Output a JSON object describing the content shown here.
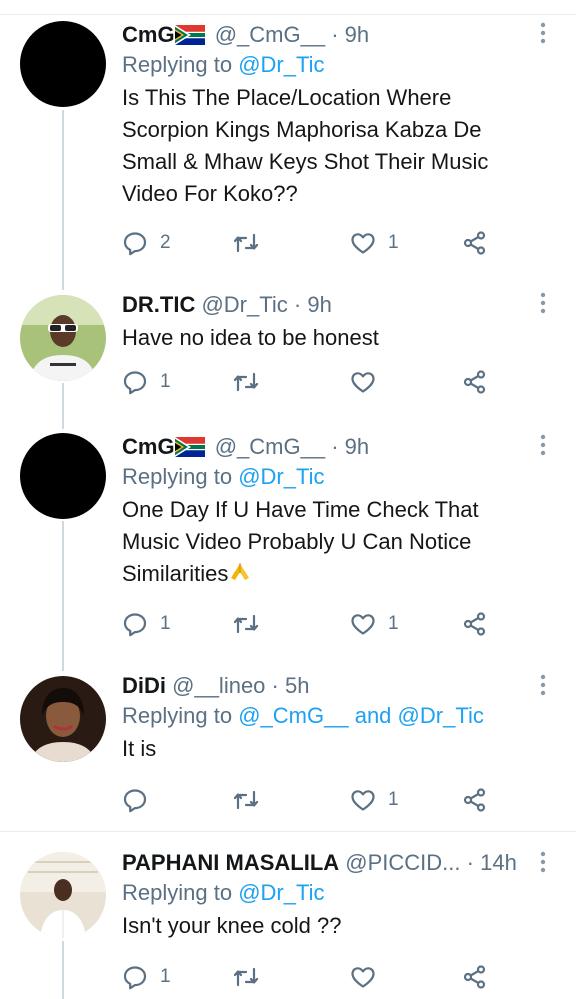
{
  "tweets": [
    {
      "name": "CmG",
      "handle": "@_CmG__",
      "time": "9h",
      "replying_label": "Replying to",
      "replying_to": "@Dr_Tic",
      "text_lines": [
        "Is This The Place/Location Where",
        "Scorpion Kings Maphorisa Kabza De",
        "Small & Mhaw Keys Shot Their Music",
        "Video For Koko??"
      ],
      "replies": "2",
      "retweets": "",
      "likes": "1",
      "avatar": "black-avatar"
    },
    {
      "name": "DR.TIC",
      "handle": "@Dr_Tic",
      "time": "9h",
      "text": "Have no idea to be honest",
      "replies": "1",
      "retweets": "",
      "likes": "",
      "avatar": "photo-avatar"
    },
    {
      "name": "CmG",
      "handle": "@_CmG__",
      "time": "9h",
      "replying_label": "Replying to",
      "replying_to": "@Dr_Tic",
      "text_lines": [
        "One Day If U Have Time Check That",
        "Music Video Probably U Can Notice",
        "Similarities"
      ],
      "replies": "1",
      "retweets": "",
      "likes": "1",
      "avatar": "black-avatar"
    },
    {
      "name": "DiDi",
      "handle": "@__lineo",
      "time": "5h",
      "replying_label": "Replying to",
      "replying_to": "@_CmG__",
      "replying_and": "and",
      "replying_to_2": "@Dr_Tic",
      "text": "It is",
      "replies": "",
      "retweets": "",
      "likes": "1",
      "avatar": "photo-avatar"
    },
    {
      "name": "PAPHANI MASALILA",
      "handle": "@PICCID...",
      "time": "14h",
      "replying_label": "Replying to",
      "replying_to": "@Dr_Tic",
      "text": "Isn't your knee cold ??",
      "replies": "1",
      "retweets": "",
      "likes": "",
      "avatar": "photo-avatar"
    }
  ],
  "separator": "·",
  "colors": {
    "accent": "#1da1f2",
    "secondary_text": "#5b7083",
    "primary_text": "#14171a",
    "divider": "#e6ecf0"
  },
  "icons": [
    "reply-icon",
    "retweet-icon",
    "like-icon",
    "share-icon",
    "more-icon",
    "south-africa-flag-icon",
    "folded-hands-emoji"
  ]
}
